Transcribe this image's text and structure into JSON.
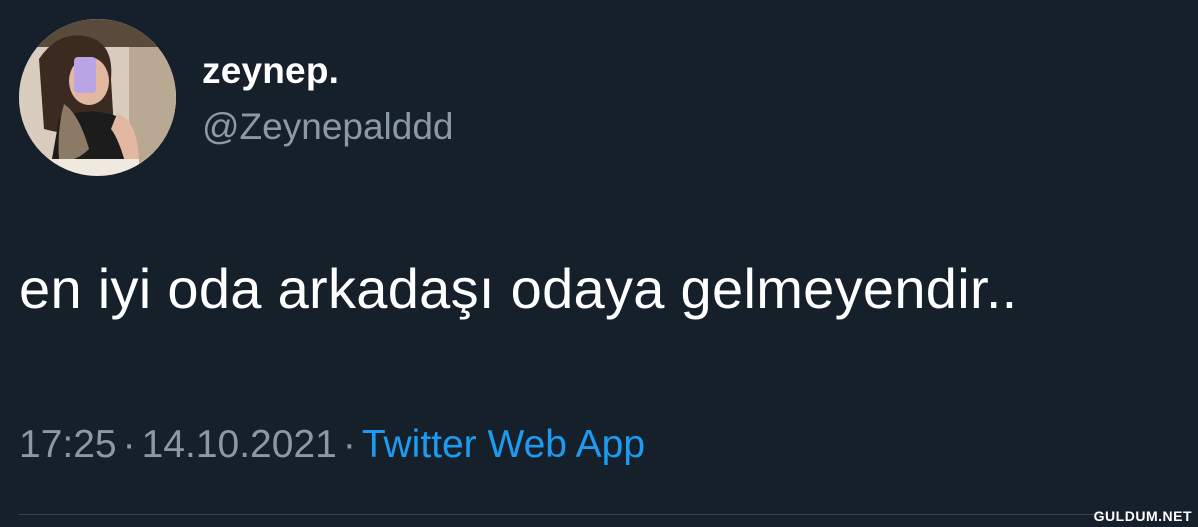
{
  "tweet": {
    "display_name": "zeynep.",
    "handle": "@Zeynepalddd",
    "text": "en iyi oda arkadaşı odaya gelmeyendir..",
    "time": "17:25",
    "date": "14.10.2021",
    "separator": "·",
    "source": "Twitter Web App"
  },
  "watermark": "GULDUM.NET",
  "colors": {
    "background": "#15202b",
    "primary_text": "#ffffff",
    "secondary_text": "#8b98a5",
    "link": "#1d9bf0"
  }
}
